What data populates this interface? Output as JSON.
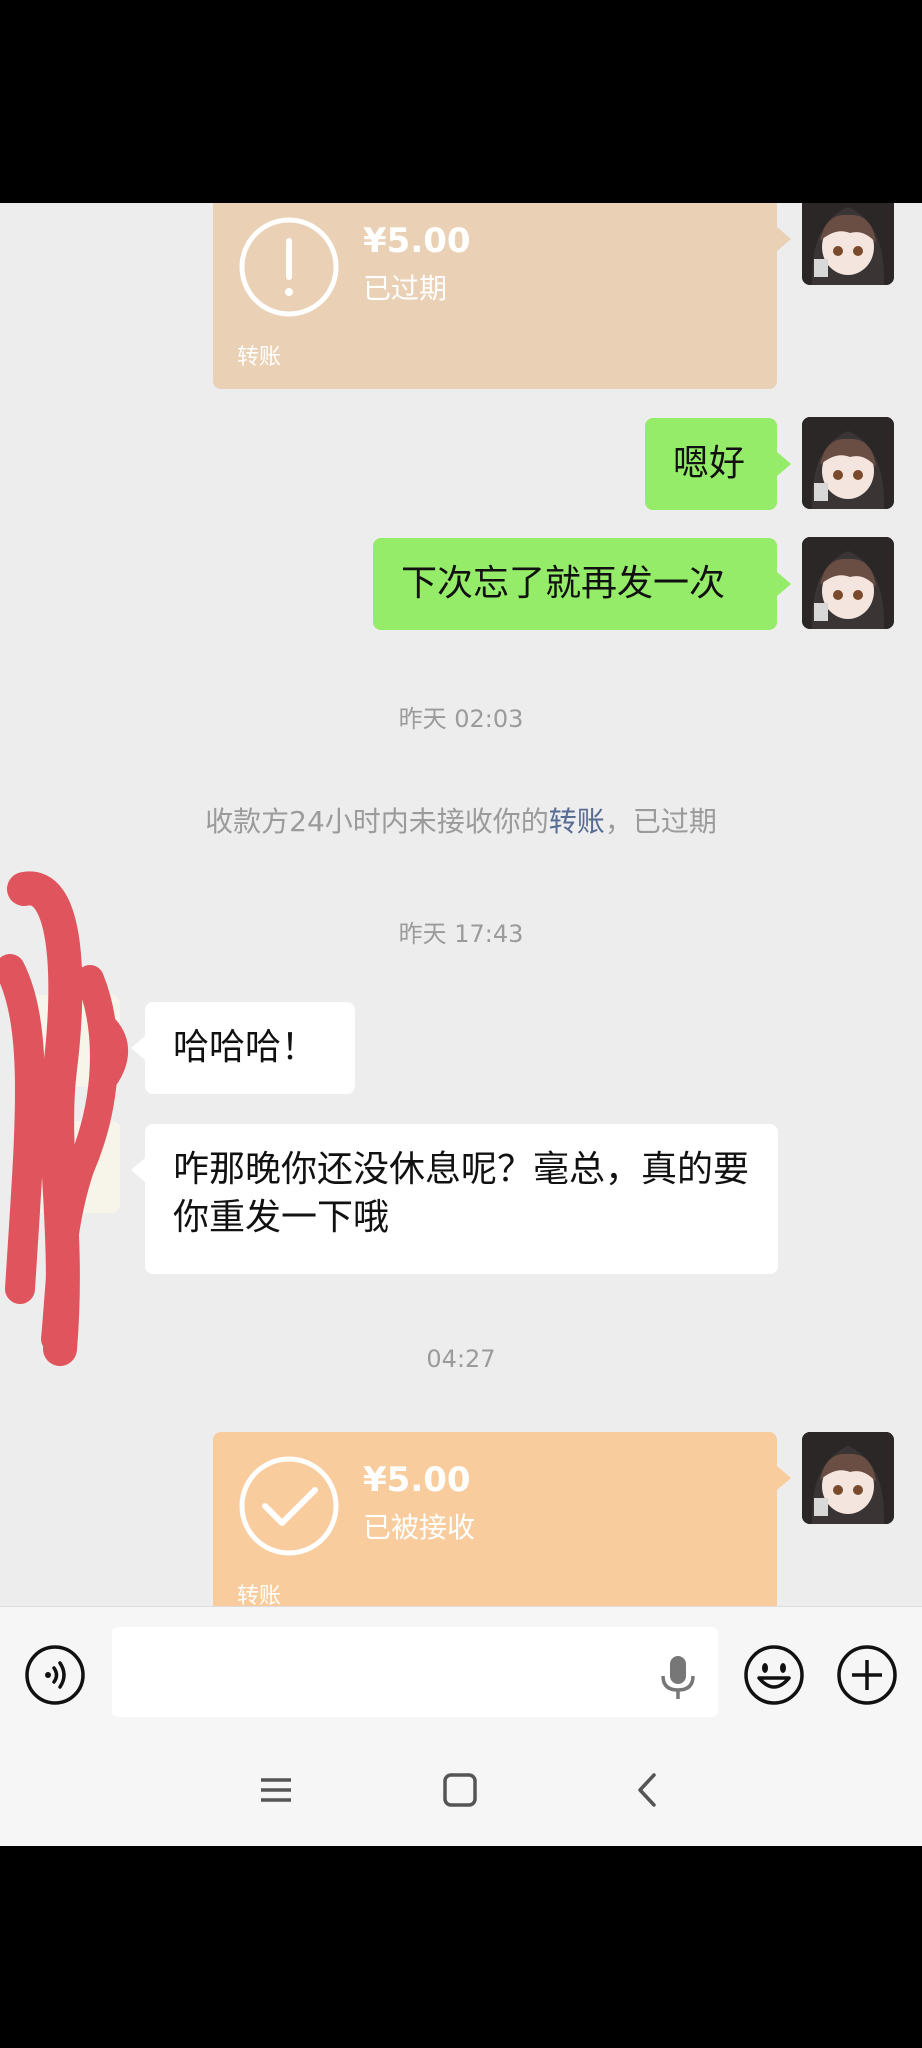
{
  "messages": {
    "transfer_1": {
      "amount": "¥5.00",
      "status": "已过期",
      "label": "转账"
    },
    "msg_1": "嗯好",
    "msg_2": "下次忘了就再发一次",
    "time_1": "昨天 02:03",
    "system_1": {
      "prefix": "收款方24小时内未接收你的",
      "link": "转账",
      "suffix": "，已过期"
    },
    "time_2": "昨天 17:43",
    "msg_3": "哈哈哈！",
    "msg_4": "咋那晚你还没休息呢？毫总，真的要你重发一下哦",
    "time_3": "04:27",
    "transfer_2": {
      "amount": "¥5.00",
      "status": "已被接收",
      "label": "转账"
    }
  },
  "input_bar": {
    "voice_icon": "voice-toggle-icon",
    "mic_icon": "microphone-icon",
    "emoji_icon": "emoji-icon",
    "plus_icon": "plus-icon",
    "text_value": ""
  },
  "nav_bar": {
    "menu_icon": "menu-icon",
    "home_icon": "home-icon",
    "back_icon": "back-icon"
  },
  "colors": {
    "my_bubble": "#95ec69",
    "their_bubble": "#ffffff",
    "chat_bg": "#ededed",
    "transfer_expired": "#ead0b4",
    "transfer_received": "#f9cc9d",
    "link": "#576b95",
    "redaction": "#e0555d"
  }
}
